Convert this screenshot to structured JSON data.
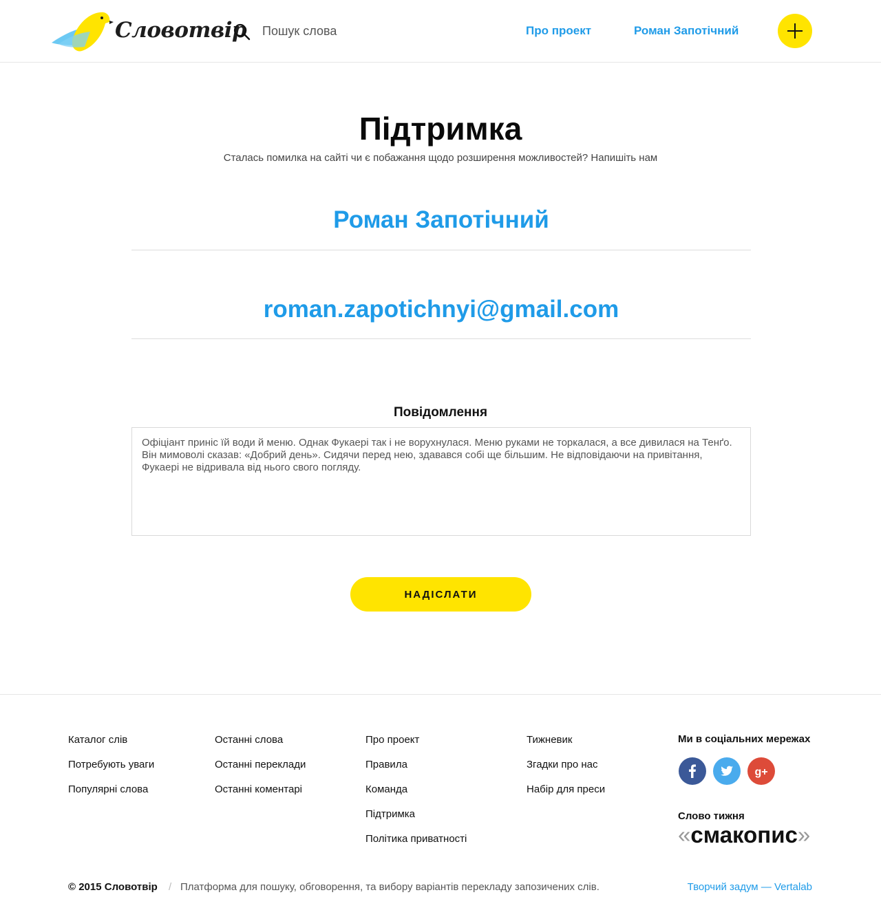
{
  "header": {
    "logo_text": "Словотвір",
    "search_placeholder": "Пошук слова",
    "nav_about": "Про проект",
    "nav_user": "Роман Запотічний"
  },
  "main": {
    "title": "Підтримка",
    "subtitle": "Сталась помилка на сайті чи є побажання щодо розширення можливостей? Напишіть нам",
    "name_value": "Роман Запотічний",
    "email_value": "roman.zapotichnyi@gmail.com",
    "message_label": "Повідомлення",
    "message_value": "Офіціант приніс їй води й меню. Однак Фукаері так і не ворухнулася. Меню руками не торкалася, а все дивилася на Тенґо. Він мимоволі сказав: «Добрий день». Сидячи перед нею, здавався собі ще більшим. Не відповідаючи на привітання, Фукаері не відривала від нього свого погляду.",
    "send_label": "НАДІСЛАТИ"
  },
  "footer": {
    "col1": [
      "Каталог слів",
      "Потребують уваги",
      "Популярні слова"
    ],
    "col2": [
      "Останні слова",
      "Останні переклади",
      "Останні коментарі"
    ],
    "col3": [
      "Про проект",
      "Правила",
      "Команда",
      "Підтримка",
      "Політика приватності"
    ],
    "col4": [
      "Тижневик",
      "Згадки про нас",
      "Набір для преси"
    ],
    "social_title": "Ми в соціальних мережах",
    "word_of_week_title": "Слово тижня",
    "word_of_week": "смакопис",
    "quote_open": "«",
    "quote_close": "»",
    "copyright": "© 2015 Словотвір",
    "separator": "/",
    "tagline": "Платформа для пошуку, обговорення, та вибору варіантів перекладу запозичених слів.",
    "credit": "Творчий задум — Vertalab"
  },
  "colors": {
    "accent_blue": "#1f9be8",
    "accent_yellow": "#ffe400",
    "facebook": "#3b5998",
    "twitter": "#4aabed",
    "google_plus": "#dd4b39"
  }
}
